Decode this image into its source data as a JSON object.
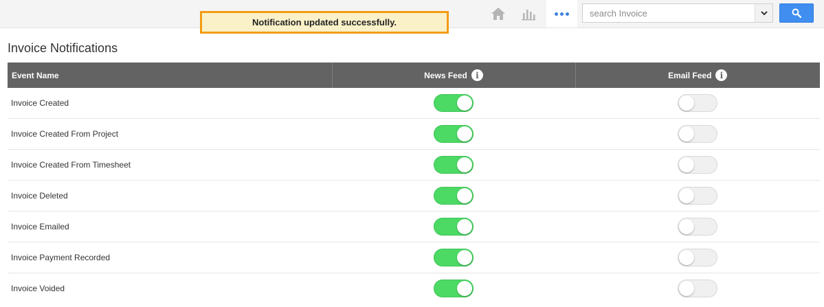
{
  "notification": {
    "message": "Notification updated successfully."
  },
  "toolbar": {
    "icons": [
      "home-icon",
      "bar-chart-icon",
      "more-icon"
    ],
    "accent_color": "#3b82e0"
  },
  "search": {
    "placeholder": "search Invoice",
    "value": "",
    "button_color": "#3f8ef0"
  },
  "page": {
    "title": "Invoice Notifications"
  },
  "table": {
    "headers": {
      "event_name": "Event Name",
      "news_feed": "News Feed",
      "email_feed": "Email Feed"
    },
    "rows": [
      {
        "event": "Invoice Created",
        "news_feed": true,
        "email_feed": false
      },
      {
        "event": "Invoice Created From Project",
        "news_feed": true,
        "email_feed": false
      },
      {
        "event": "Invoice Created From Timesheet",
        "news_feed": true,
        "email_feed": false
      },
      {
        "event": "Invoice Deleted",
        "news_feed": true,
        "email_feed": false
      },
      {
        "event": "Invoice Emailed",
        "news_feed": true,
        "email_feed": false
      },
      {
        "event": "Invoice Payment Recorded",
        "news_feed": true,
        "email_feed": false
      },
      {
        "event": "Invoice Voided",
        "news_feed": true,
        "email_feed": false
      }
    ],
    "toggle_on_color": "#4cd964",
    "header_color": "#636363"
  }
}
